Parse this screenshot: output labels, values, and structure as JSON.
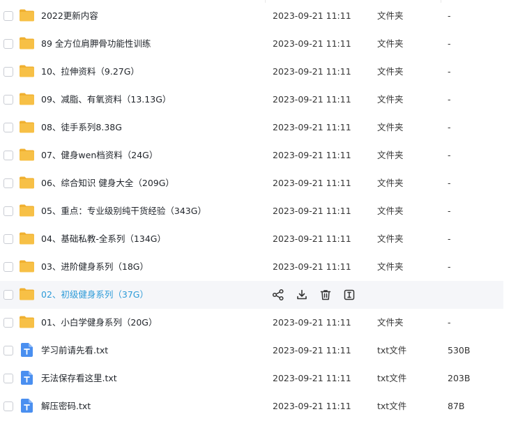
{
  "rows": [
    {
      "name": "2022更新内容",
      "date": "2023-09-21 11:11",
      "type": "文件夹",
      "size": "-",
      "icon": "folder-icon"
    },
    {
      "name": "89 全方位肩胛骨功能性训练",
      "date": "2023-09-21 11:11",
      "type": "文件夹",
      "size": "-",
      "icon": "folder-icon"
    },
    {
      "name": "10、拉伸资料（9.27G）",
      "date": "2023-09-21 11:11",
      "type": "文件夹",
      "size": "-",
      "icon": "folder-icon"
    },
    {
      "name": "09、减脂、有氧资料（13.13G）",
      "date": "2023-09-21 11:11",
      "type": "文件夹",
      "size": "-",
      "icon": "folder-icon"
    },
    {
      "name": "08、徒手系列8.38G",
      "date": "2023-09-21 11:11",
      "type": "文件夹",
      "size": "-",
      "icon": "folder-icon"
    },
    {
      "name": "07、健身wen档资料（24G）",
      "date": "2023-09-21 11:11",
      "type": "文件夹",
      "size": "-",
      "icon": "folder-icon"
    },
    {
      "name": "06、综合知识 健身大全（209G）",
      "date": "2023-09-21 11:11",
      "type": "文件夹",
      "size": "-",
      "icon": "folder-icon"
    },
    {
      "name": "05、重点：专业级别纯干货经验（343G）",
      "date": "2023-09-21 11:11",
      "type": "文件夹",
      "size": "-",
      "icon": "folder-icon"
    },
    {
      "name": "04、基础私教-全系列（134G）",
      "date": "2023-09-21 11:11",
      "type": "文件夹",
      "size": "-",
      "icon": "folder-icon"
    },
    {
      "name": "03、进阶健身系列（18G）",
      "date": "2023-09-21 11:11",
      "type": "文件夹",
      "size": "-",
      "icon": "folder-icon"
    },
    {
      "name": "02、初级健身系列（37G）",
      "date": "",
      "type": "",
      "size": "",
      "icon": "folder-icon",
      "hover": true
    },
    {
      "name": "01、小白学健身系列（20G）",
      "date": "2023-09-21 11:11",
      "type": "文件夹",
      "size": "-",
      "icon": "folder-icon"
    },
    {
      "name": "学习前请先看.txt",
      "date": "2023-09-21 11:11",
      "type": "txt文件",
      "size": "530B",
      "icon": "txt-file-icon"
    },
    {
      "name": "无法保存看这里.txt",
      "date": "2023-09-21 11:11",
      "type": "txt文件",
      "size": "203B",
      "icon": "txt-file-icon"
    },
    {
      "name": "解压密码.txt",
      "date": "2023-09-21 11:11",
      "type": "txt文件",
      "size": "87B",
      "icon": "txt-file-icon"
    }
  ],
  "hover_actions": [
    "share-icon",
    "download-icon",
    "delete-icon",
    "rename-icon"
  ],
  "colors": {
    "folder": "#f7c046",
    "folder_dark": "#f0b030",
    "txt_icon": "#4a8ff0",
    "hover_text": "#2d9bd8",
    "hover_bg": "#f5f6f9"
  }
}
